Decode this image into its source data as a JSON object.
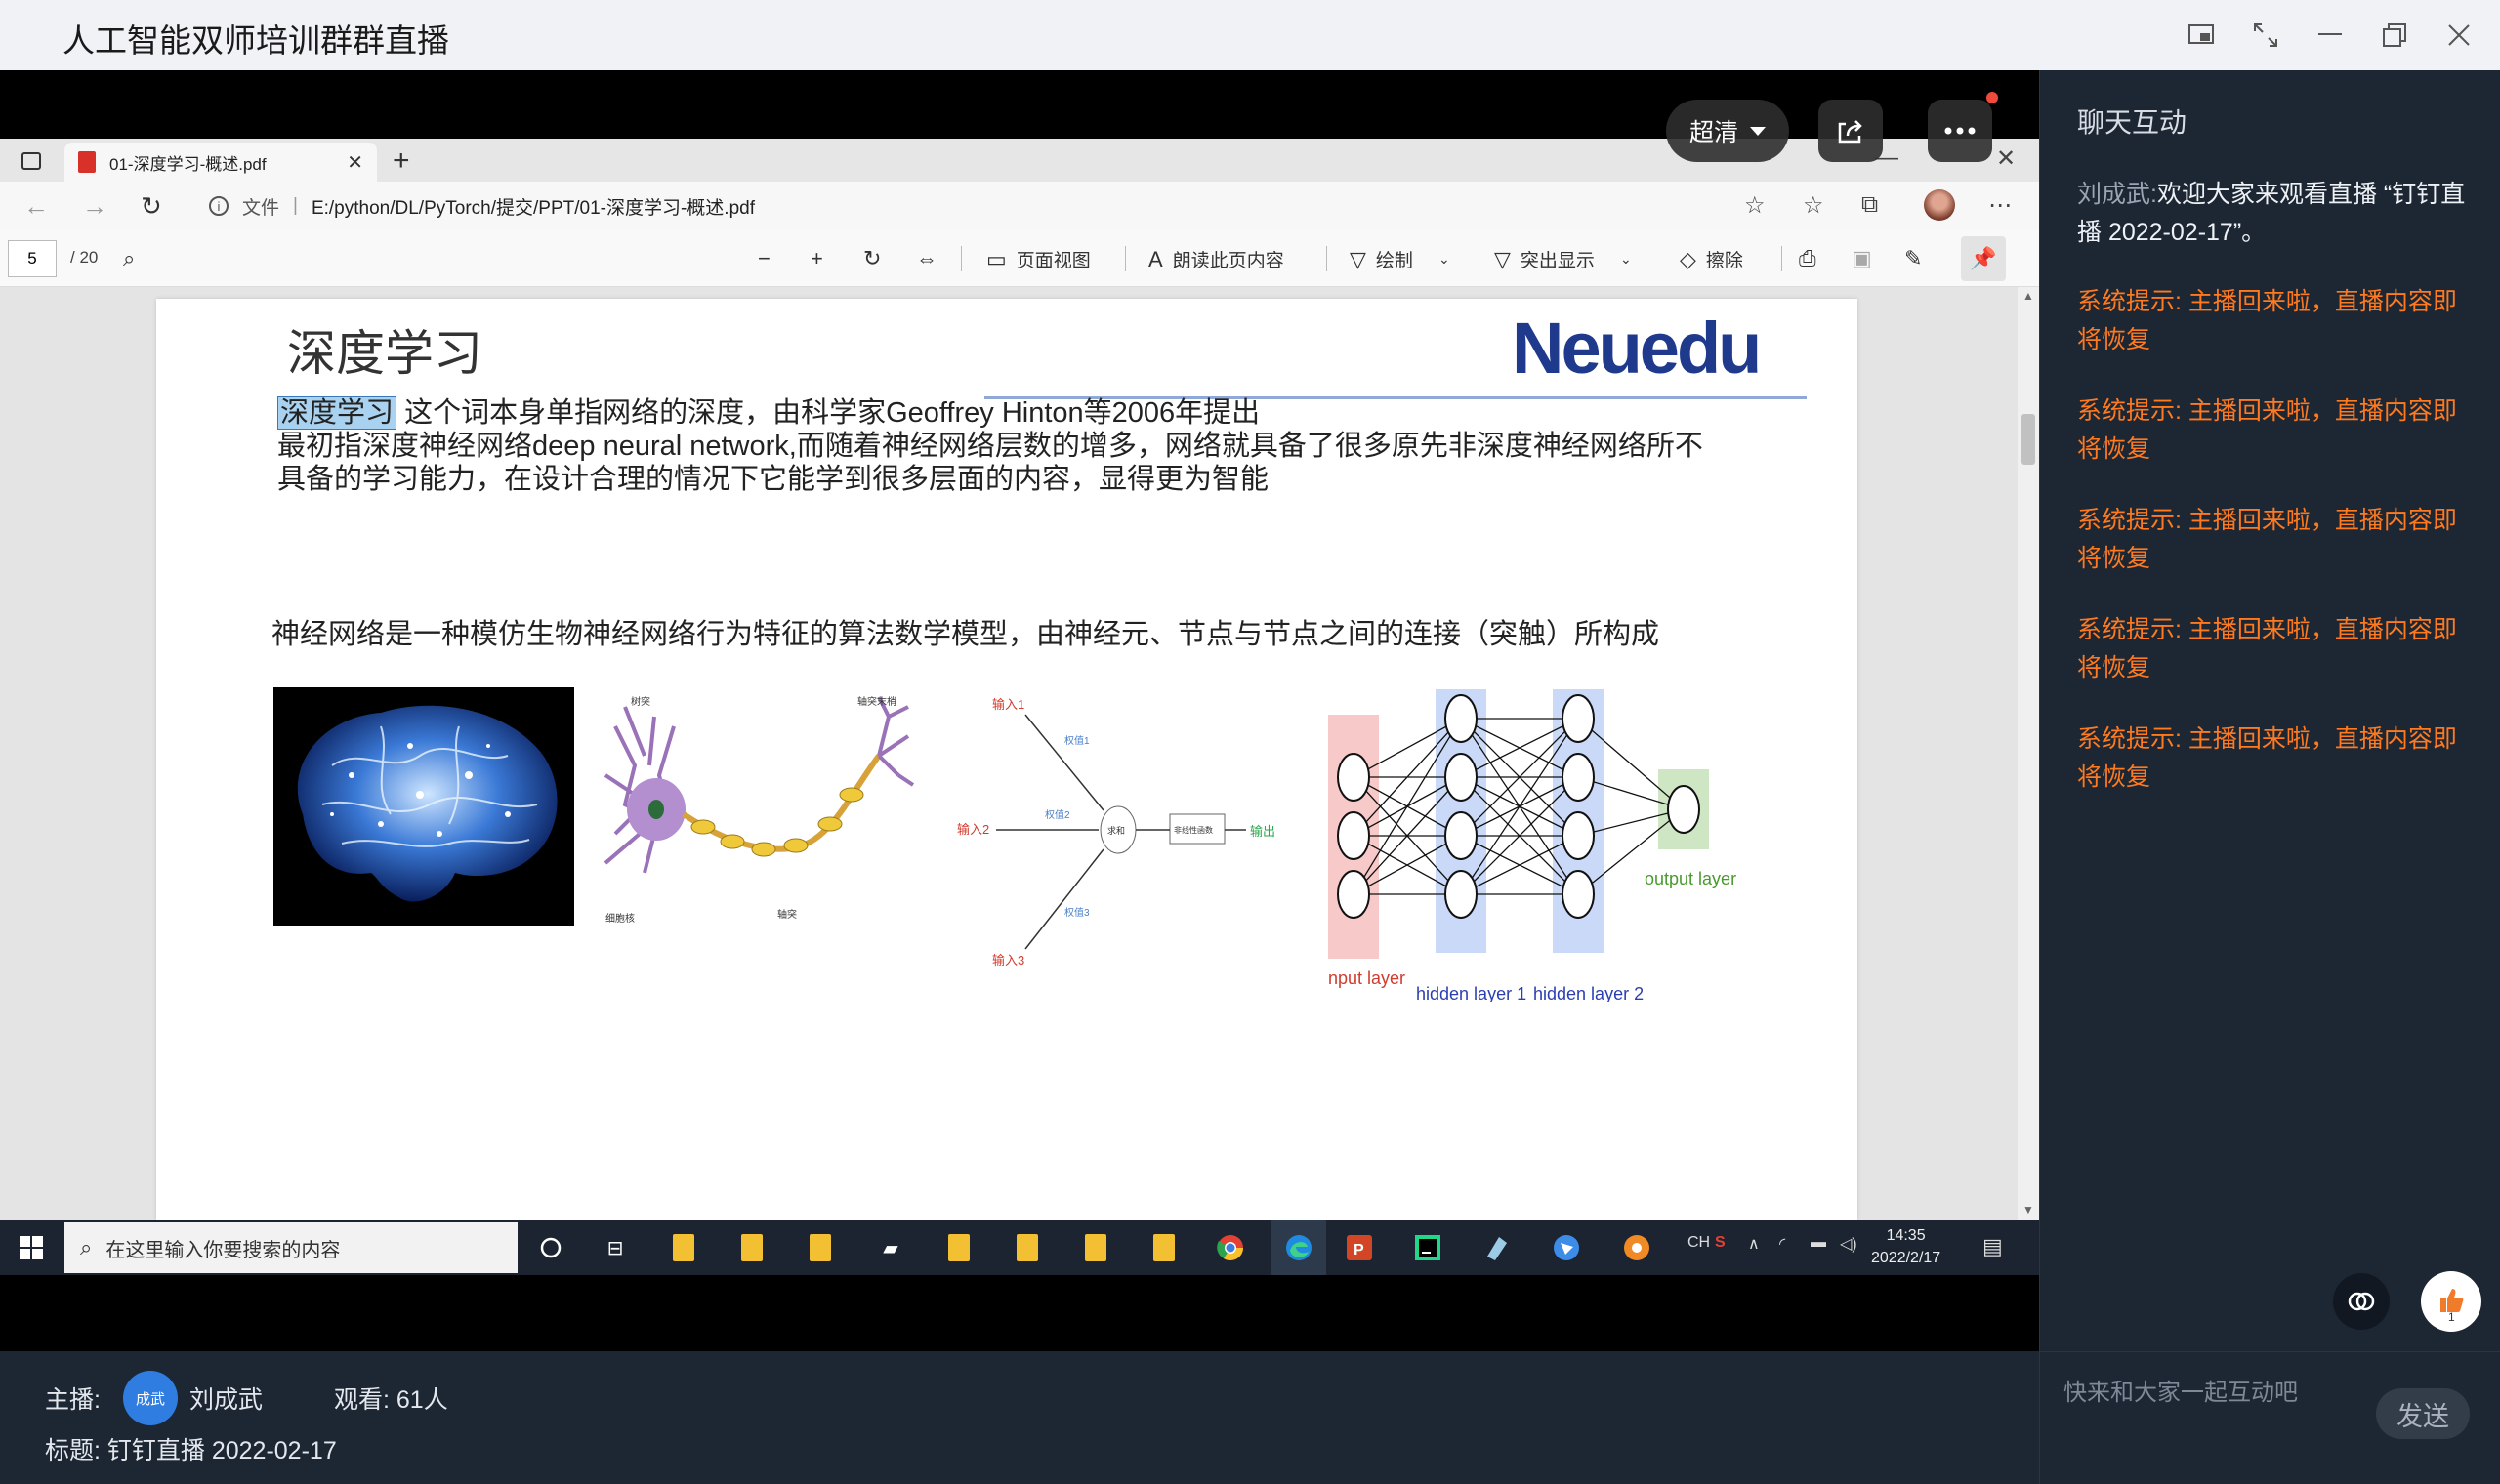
{
  "window": {
    "title": "人工智能双师培训群群直播",
    "controls": [
      "pip-icon",
      "fullscreen-icon",
      "minimize-icon",
      "restore-icon",
      "close-icon"
    ]
  },
  "video_overlay": {
    "quality_label": "超清",
    "share_icon": "share-icon",
    "more_icon": "more-icon"
  },
  "browser": {
    "tab_title": "01-深度学习-概述.pdf",
    "url_prefix": "文件",
    "url": "E:/python/DL/PyTorch/提交/PPT/01-深度学习-概述.pdf"
  },
  "pdf_toolbar": {
    "current_page": "5",
    "total_pages": "/ 20",
    "page_view": "页面视图",
    "read_aloud": "朗读此页内容",
    "draw": "绘制",
    "highlight": "突出显示",
    "erase": "擦除"
  },
  "slide": {
    "title": "深度学习",
    "logo": "Neuedu",
    "highlight_term": "深度学习",
    "line1_rest": " 这个词本身单指网络的深度，由科学家Geoffrey Hinton等2006年提出",
    "line2": "最初指深度神经网络deep neural network,而随着神经网络层数的增多，网络就具备了很多原先非深度神经网络所不",
    "line3": "具备的学习能力，在设计合理的情况下它能学到很多层面的内容，显得更为智能",
    "para2": "神经网络是一种模仿生物神经网络行为特征的算法数学模型，由神经元、节点与节点之间的连接（突触）所构成",
    "neuron_labels": [
      "树突",
      "轴突末梢",
      "细胞核",
      "轴突"
    ],
    "perceptron_labels": [
      "输入1",
      "输入2",
      "输入3",
      "权值1",
      "权值2",
      "权值3",
      "求和",
      "非线性函数",
      "输出"
    ],
    "nn_labels": {
      "input": "input layer",
      "hidden1": "hidden layer 1",
      "hidden2": "hidden layer 2",
      "output": "output layer"
    }
  },
  "taskbar": {
    "search_placeholder": "在这里输入你要搜索的内容",
    "time": "14:35",
    "date": "2022/2/17"
  },
  "stream_info": {
    "host_label": "主播:",
    "host_avatar_text": "成武",
    "host_name": "刘成武",
    "viewers": "观看: 61人",
    "topic": "标题: 钉钉直播 2022-02-17"
  },
  "chat": {
    "title": "聊天互动",
    "messages": [
      {
        "name": "刘成武:",
        "text": "欢迎大家来观看直播 “钉钉直播 2022-02-17”。"
      },
      {
        "text": "系统提示: 主播回来啦，直播内容即将恢复"
      },
      {
        "text": "系统提示: 主播回来啦，直播内容即将恢复"
      },
      {
        "text": "系统提示: 主播回来啦，直播内容即将恢复"
      },
      {
        "text": "系统提示: 主播回来啦，直播内容即将恢复"
      },
      {
        "text": "系统提示: 主播回来啦，直播内容即将恢复"
      }
    ],
    "like_count": "1",
    "input_placeholder": "快来和大家一起互动吧",
    "send_label": "发送"
  },
  "colors": {
    "chat_bg": "#1d2733",
    "system_msg": "#ff7a1f",
    "logo": "#1f3a8c"
  }
}
